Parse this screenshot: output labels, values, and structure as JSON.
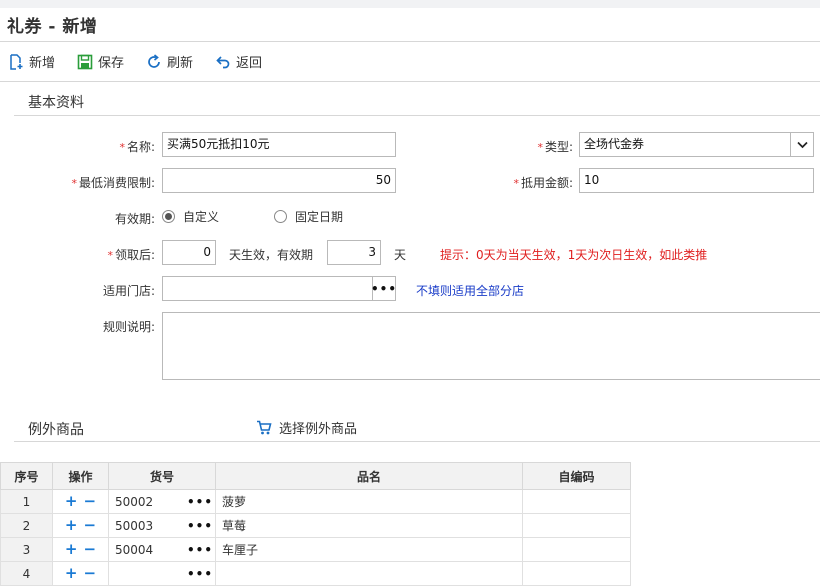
{
  "title": "礼券 - 新增",
  "toolbar": {
    "add": "新增",
    "save": "保存",
    "refresh": "刷新",
    "back": "返回"
  },
  "section_basic": "基本资料",
  "form": {
    "name_label": "名称:",
    "name_value": "买满50元抵扣10元",
    "type_label": "类型:",
    "type_value": "全场代金券",
    "min_spend_label": "最低消费限制:",
    "min_spend_value": "50",
    "deduct_label": "抵用金额:",
    "deduct_value": "10",
    "validity_label": "有效期:",
    "validity_opt1": "自定义",
    "validity_opt2": "固定日期",
    "after_label": "领取后:",
    "after_days": "0",
    "after_text1": "天生效，有效期",
    "valid_days": "3",
    "after_text2": "天",
    "hint": "提示：0天为当天生效，1天为次日生效，如此类推",
    "store_label": "适用门店:",
    "store_value": "",
    "store_hint": "不填则适用全部分店",
    "rule_label": "规则说明:",
    "rule_value": ""
  },
  "section_excl": "例外商品",
  "select_excl": "选择例外商品",
  "grid": {
    "headers": [
      "序号",
      "操作",
      "货号",
      "品名",
      "自编码"
    ],
    "rows": [
      {
        "no": "1",
        "code": "50002",
        "name": "菠萝",
        "own": ""
      },
      {
        "no": "2",
        "code": "50003",
        "name": "草莓",
        "own": ""
      },
      {
        "no": "3",
        "code": "50004",
        "name": "车厘子",
        "own": ""
      },
      {
        "no": "4",
        "code": "",
        "name": "",
        "own": ""
      }
    ]
  },
  "colors": {
    "required": "#e03030",
    "hint_red": "#e02020",
    "hint_blue": "#1a3cc8",
    "icon_blue": "#1a7ad4",
    "icon_green": "#2a9d3a"
  }
}
